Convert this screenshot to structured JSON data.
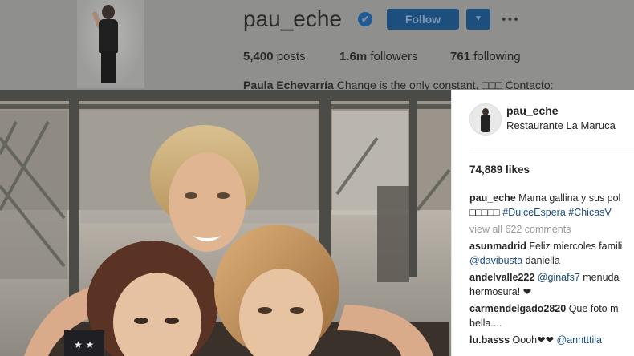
{
  "profile": {
    "username": "pau_eche",
    "verified_icon": "✔",
    "follow_label": "Follow",
    "dropdown_icon": "▼",
    "more_icon": "•••",
    "posts_count": "5,400",
    "posts_label": "posts",
    "followers_count": "1.6m",
    "followers_label": "followers",
    "following_count": "761",
    "following_label": "following",
    "bio_name": "Paula Echevarría",
    "bio_text": "Change is the only constant. □□□ Contacto:"
  },
  "post": {
    "owner": "pau_eche",
    "location": "Restaurante La Maruca",
    "likes": "74,889 likes",
    "caption_user": "pau_eche",
    "caption_text": "Mama gallina y sus pol",
    "caption_line2_boxes": "□□□□□",
    "caption_tags": "#DulceEspera #ChicasV",
    "view_all": "view all 622 comments",
    "comments": [
      {
        "user": "asunmadrid",
        "text": "Feliz miercoles famili",
        "line2_tag": "@davibusta",
        "line2_text": " daniella"
      },
      {
        "user": "andelvalle222",
        "tag": "@ginafs7",
        "text": " menuda",
        "line2_text": "hermosura! ❤"
      },
      {
        "user": "carmendelgado2820",
        "text": "Que foto m",
        "line2_text": "bella...."
      },
      {
        "user": "lu.basss",
        "text": "Oooh❤❤ ",
        "tag": "@anntttiia"
      }
    ]
  },
  "colors": {
    "accent_blue": "#1c4f7e",
    "overlay_gray": "#8f8f8e"
  }
}
